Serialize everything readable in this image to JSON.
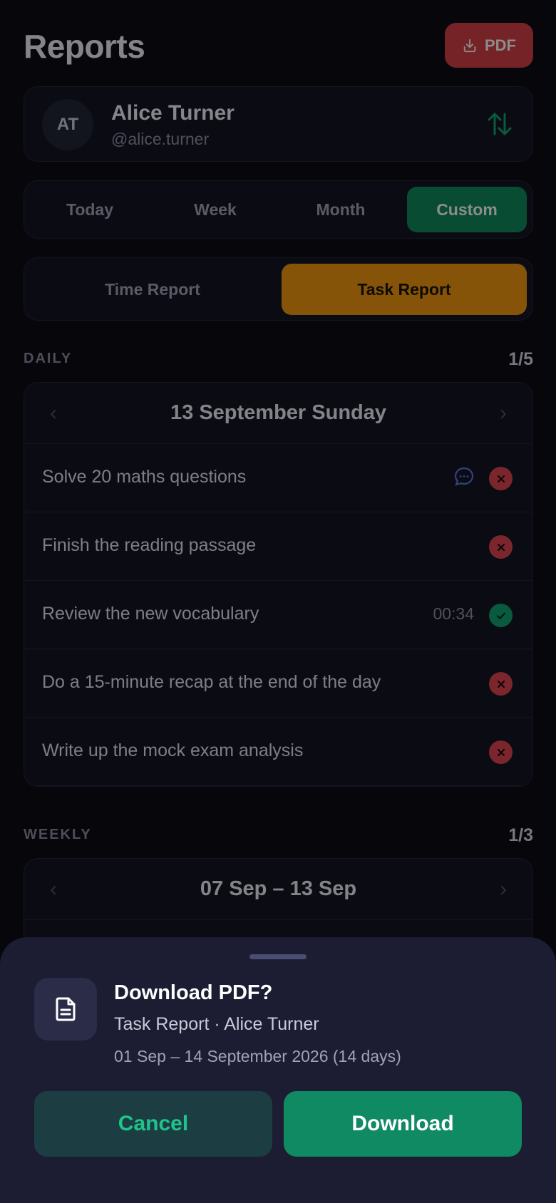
{
  "header": {
    "title": "Reports",
    "pdf_label": "PDF"
  },
  "profile": {
    "initials": "AT",
    "name": "Alice Turner",
    "handle": "@alice.turner"
  },
  "period_tabs": [
    {
      "label": "Today",
      "active": false
    },
    {
      "label": "Week",
      "active": false
    },
    {
      "label": "Month",
      "active": false
    },
    {
      "label": "Custom",
      "active": true
    }
  ],
  "report_tabs": [
    {
      "label": "Time Report",
      "active": false
    },
    {
      "label": "Task Report",
      "active": true
    }
  ],
  "daily": {
    "label": "DAILY",
    "count": "1/5",
    "date": "13 September Sunday",
    "tasks": [
      {
        "text": "Solve 20 maths questions",
        "status": "fail",
        "has_comment": true,
        "time": ""
      },
      {
        "text": "Finish the reading passage",
        "status": "fail",
        "has_comment": false,
        "time": ""
      },
      {
        "text": "Review the new vocabulary",
        "status": "done",
        "has_comment": false,
        "time": "00:34"
      },
      {
        "text": "Do a 15-minute recap at the end of the day",
        "status": "fail",
        "has_comment": false,
        "time": ""
      },
      {
        "text": "Write up the mock exam analysis",
        "status": "fail",
        "has_comment": false,
        "time": ""
      }
    ]
  },
  "weekly": {
    "label": "WEEKLY",
    "count": "1/3",
    "range": "07 Sep – 13 Sep"
  },
  "sheet": {
    "title": "Download PDF?",
    "subtitle": "Task Report · Alice Turner",
    "range": "01 Sep – 14 September 2026 (14 days)",
    "cancel_label": "Cancel",
    "download_label": "Download"
  },
  "colors": {
    "accent_green": "#0f8a5f",
    "accent_orange": "#f39a12",
    "danger_red": "#e14650",
    "pdf_red": "#d8404a"
  },
  "icons": {
    "pdf": "download-tray-icon",
    "swap": "swap-vertical-icon",
    "comment": "comment-bubble-icon",
    "fail": "x-icon",
    "done": "check-icon",
    "document": "document-icon"
  }
}
